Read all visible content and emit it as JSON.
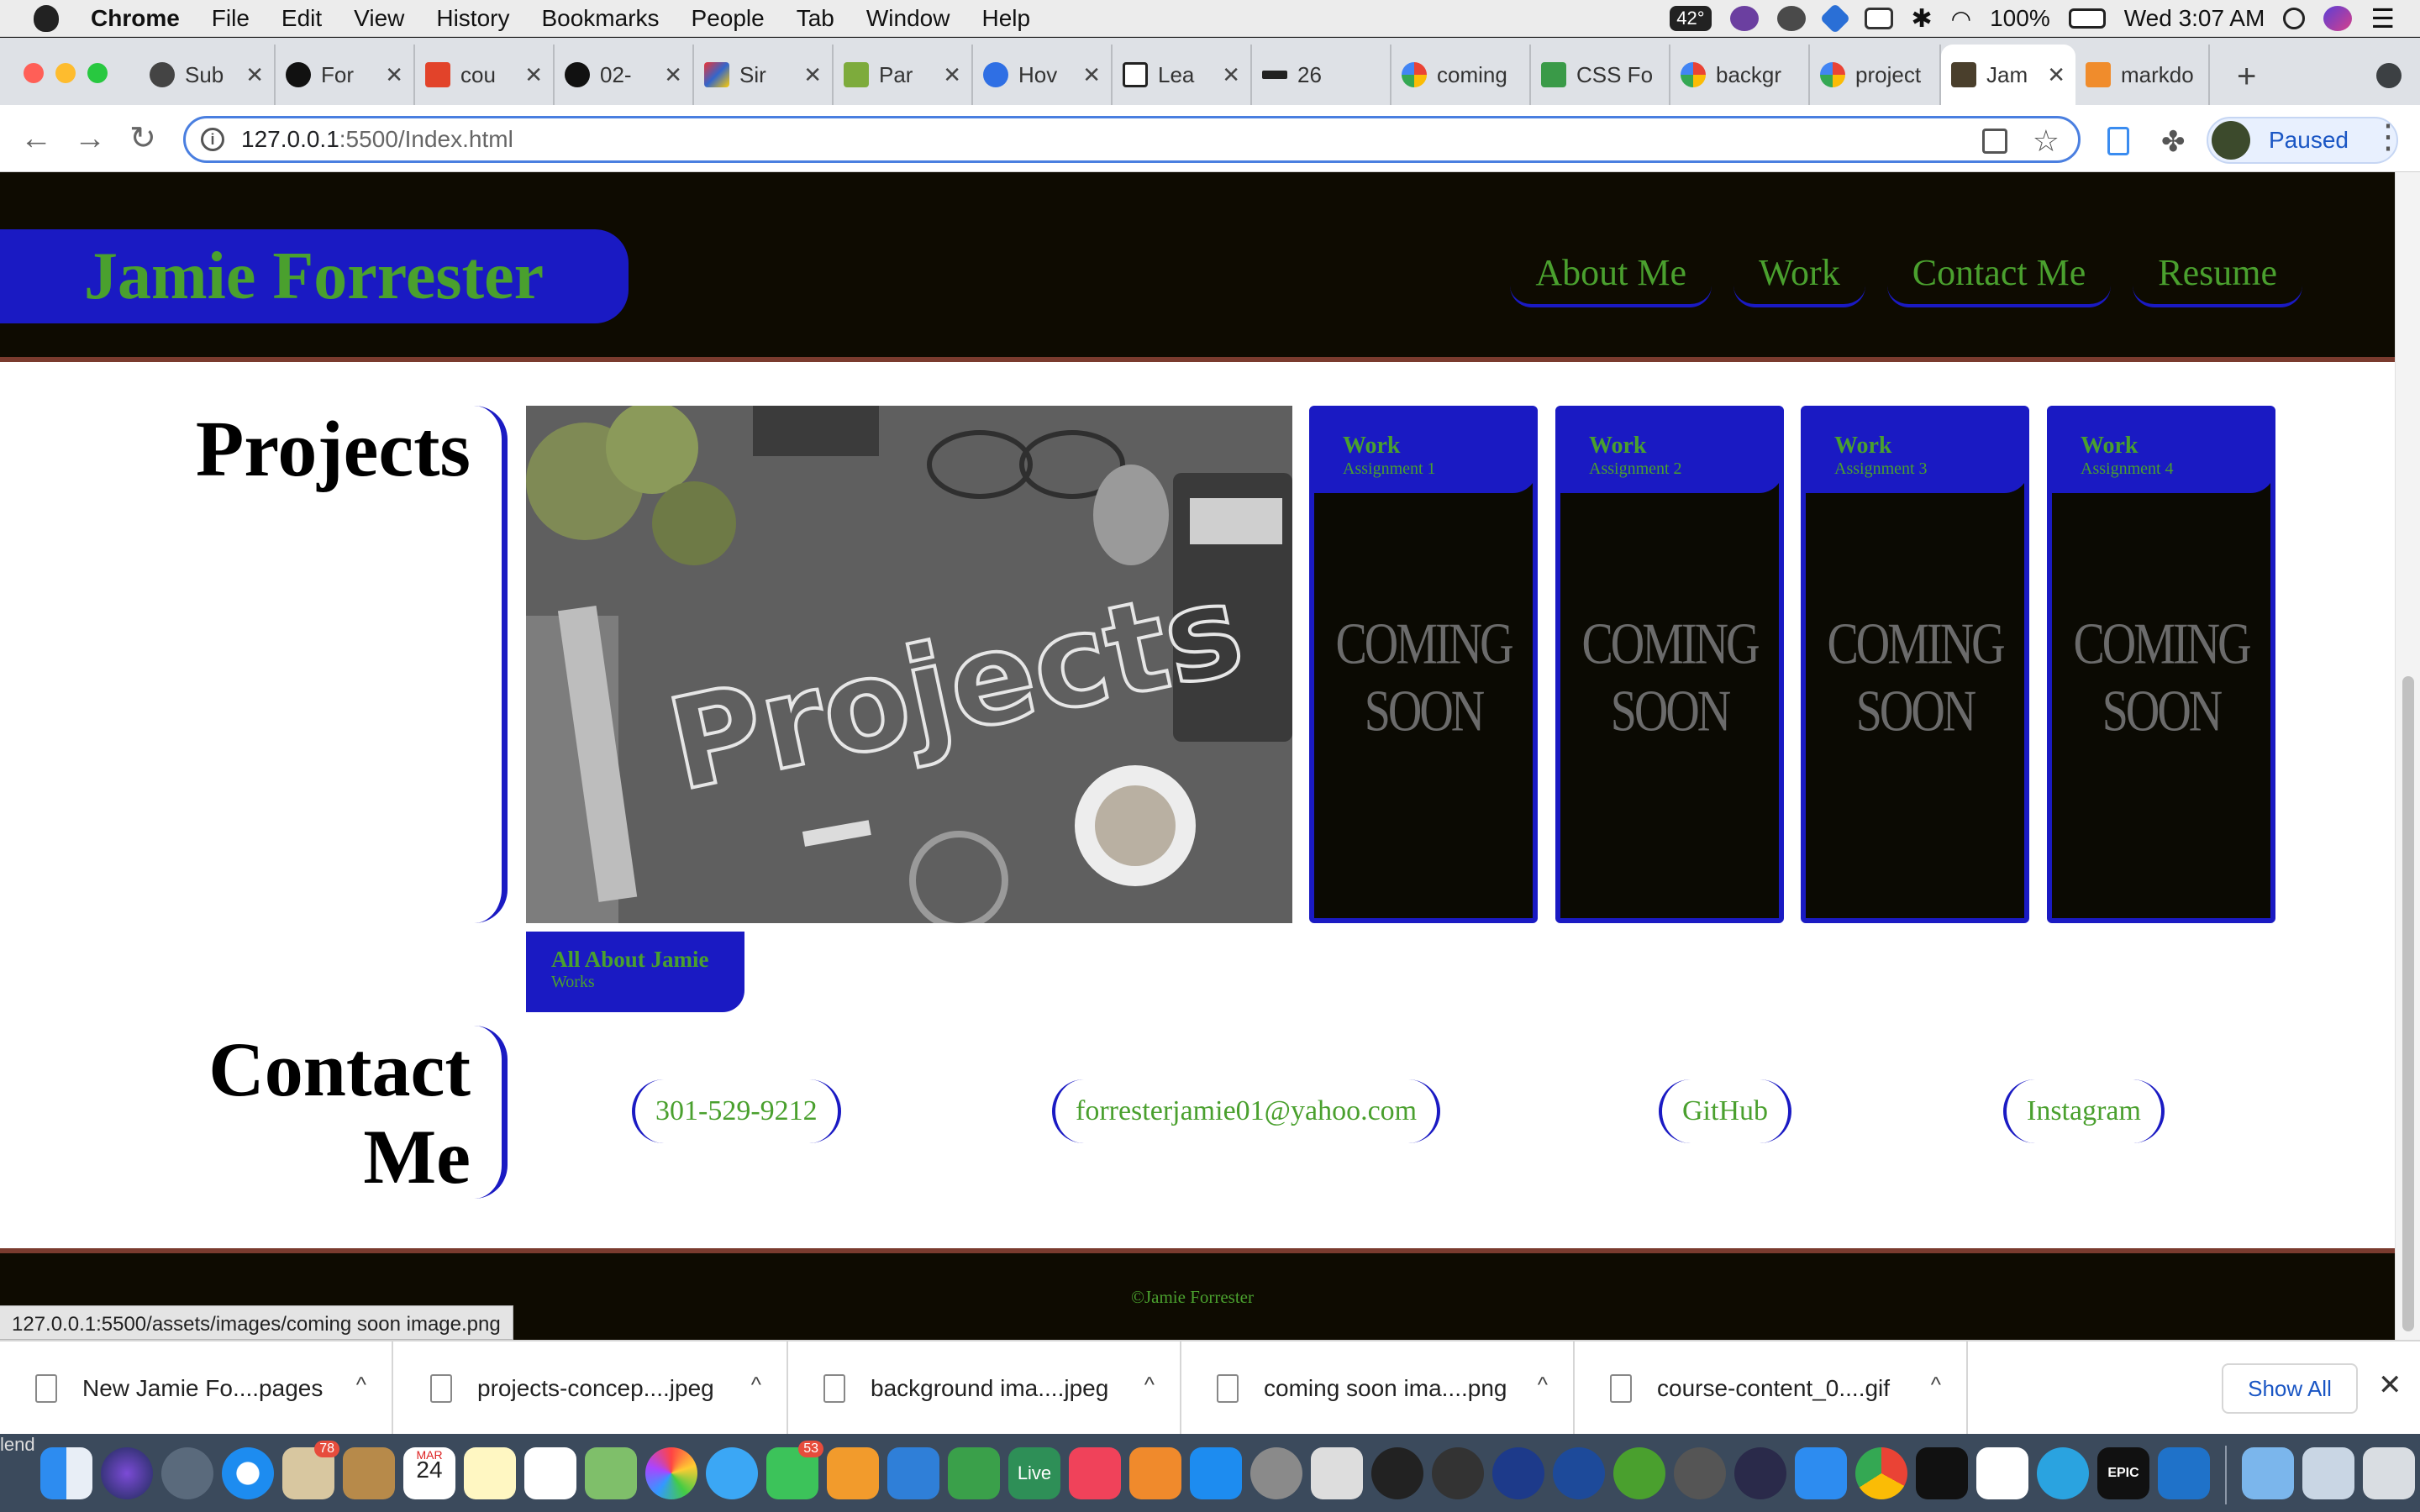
{
  "menubar": {
    "app_name": "Chrome",
    "items": [
      "File",
      "Edit",
      "View",
      "History",
      "Bookmarks",
      "People",
      "Tab",
      "Window",
      "Help"
    ],
    "weather": "42°",
    "battery": "100%",
    "clock": "Wed 3:07 AM"
  },
  "tabs": [
    {
      "title": "Sub",
      "icon": "globe-icon"
    },
    {
      "title": "For",
      "icon": "github-icon"
    },
    {
      "title": "cou",
      "icon": "gitlab-icon"
    },
    {
      "title": "02-",
      "icon": "github-icon"
    },
    {
      "title": "Sir",
      "icon": "colorful-icon"
    },
    {
      "title": "Par",
      "icon": "m-icon"
    },
    {
      "title": "Hov",
      "icon": "loop-icon"
    },
    {
      "title": "Lea",
      "icon": "shield-icon"
    },
    {
      "title": "26",
      "icon": "bar-icon"
    },
    {
      "title": "coming",
      "icon": "google-icon"
    },
    {
      "title": "CSS Fo",
      "icon": "w3-icon"
    },
    {
      "title": "backgr",
      "icon": "google-icon"
    },
    {
      "title": "project",
      "icon": "google-icon"
    },
    {
      "title": "Jam",
      "icon": "page-thumb-icon",
      "active": true
    },
    {
      "title": "markdo",
      "icon": "flame-icon"
    }
  ],
  "toolbar": {
    "url_host": "127.0.0.1",
    "url_rest": ":5500/Index.html",
    "profile_label": "Paused"
  },
  "page": {
    "brand": "Jamie Forrester",
    "nav": [
      "About Me",
      "Work",
      "Contact Me",
      "Resume"
    ],
    "projects_title": "Projects",
    "hero_word": "Projects",
    "about_card": {
      "title": "All About Jamie",
      "subtitle": "Works"
    },
    "work_cards": [
      {
        "title": "Work",
        "subtitle": "Assignment 1",
        "overlay": "COMING SOON"
      },
      {
        "title": "Work",
        "subtitle": "Assignment 2",
        "overlay": "COMING SOON"
      },
      {
        "title": "Work",
        "subtitle": "Assignment 3",
        "overlay": "COMING SOON"
      },
      {
        "title": "Work",
        "subtitle": "Assignment 4",
        "overlay": "COMING SOON"
      }
    ],
    "contact_title_line1": "Contact",
    "contact_title_line2": "Me",
    "contact_links": [
      "301-529-9212",
      "forresterjamie01@yahoo.com",
      "GitHub",
      "Instagram"
    ],
    "footer": "©Jamie Forrester",
    "status_url": "127.0.0.1:5500/assets/images/coming soon image.png"
  },
  "downloads": {
    "files": [
      "New Jamie Fo....pages",
      "projects-concep....jpeg",
      "background ima....jpeg",
      "coming soon ima....png",
      "course-content_0....gif"
    ],
    "show_all": "Show All"
  },
  "dock": {
    "edge_text": "lend",
    "calendar_month": "MAR",
    "calendar_day": "24",
    "mail_badge": "78",
    "facetime_badge": "53",
    "live_label": "Live",
    "epic_label": "EPIC"
  },
  "colors": {
    "header_bg": "#0e0b01",
    "accent_blue": "#1a1ac3",
    "accent_green": "#4aa02e",
    "divider": "#7a3b2e"
  }
}
